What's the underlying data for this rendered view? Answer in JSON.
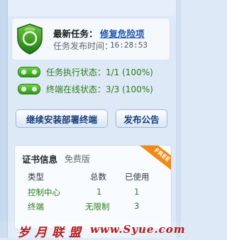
{
  "task": {
    "label": "最新任务：",
    "value": "修复危险项",
    "publish_time_label": "任务发布时间：",
    "publish_time": "16:28:53"
  },
  "status": {
    "execution": "任务执行状态：1/1 (100%)",
    "online": "终端在线状态：3/3 (100%)"
  },
  "buttons": {
    "deploy": "继续安装部署终端",
    "publish": "发布公告"
  },
  "cert": {
    "title": "证书信息",
    "edition": "免费版",
    "badge": "FREE",
    "headers": [
      "类型",
      "总数",
      "已使用"
    ],
    "rows": [
      [
        "控制中心",
        "1",
        "1"
      ],
      [
        "终端",
        "无限制",
        "3"
      ]
    ]
  },
  "watermark": {
    "left": "岁月联盟",
    "right": "www.Syue.com"
  },
  "colors": {
    "accent": "#1f56b0",
    "status_green": "#2e7a16",
    "badge_orange": "#f08a12",
    "watermark_red": "#b61b1b"
  }
}
